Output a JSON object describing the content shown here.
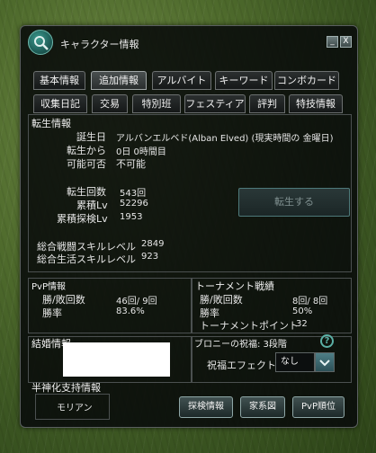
{
  "window": {
    "title": "キャラクター情報",
    "minimize_label": "_",
    "close_label": "X"
  },
  "tabs_row1": [
    {
      "label": "基本情報",
      "active": false
    },
    {
      "label": "追加情報",
      "active": true
    },
    {
      "label": "アルバイト",
      "active": false
    },
    {
      "label": "キーワード",
      "active": false
    },
    {
      "label": "コンボカード",
      "active": false
    }
  ],
  "tabs_row2": [
    {
      "label": "収集日記"
    },
    {
      "label": "交易"
    },
    {
      "label": "特別班"
    },
    {
      "label": "フェスティア"
    },
    {
      "label": "評判"
    },
    {
      "label": "特技情報"
    }
  ],
  "rebirth": {
    "section_title": "転生情報",
    "birthday_label": "誕生日",
    "birthday_value": "アルバンエルベド(Alban Elved) (現実時間の 金曜日)",
    "since_label": "転生から",
    "since_value": "0日 0時間目",
    "possible_label": "可能可否",
    "possible_value": "不可能",
    "count_label": "転生回数",
    "count_value": "543回",
    "total_level_label": "累積Lv",
    "total_level_value": "52296",
    "explore_level_label": "累積探検Lv",
    "explore_level_value": "1953",
    "button_label": "転生する"
  },
  "skills": {
    "combat_label": "総合戦闘スキルレベル",
    "combat_value": "2849",
    "life_label": "総合生活スキルレベル",
    "life_value": "923"
  },
  "pvp": {
    "title": "PvP情報",
    "wl_label": "勝/敗回数",
    "wl_value": "46回/ 9回",
    "rate_label": "勝率",
    "rate_value": "83.6%"
  },
  "tournament": {
    "title": "トーナメント戦績",
    "wl_label": "勝/敗回数",
    "wl_value": "8回/ 8回",
    "rate_label": "勝率",
    "rate_value": "50%",
    "points_label": "トーナメントポイント",
    "points_value": "32"
  },
  "marriage": {
    "title": "結婚情報"
  },
  "blessing": {
    "title": "ブロニーの祝福: 3段階",
    "help_label": "?",
    "effect_label": "祝福エフェクト",
    "effect_value": "なし"
  },
  "demigod": {
    "title": "半神化支持情報",
    "value": "モリアン"
  },
  "bottom_buttons": {
    "explore": "探検情報",
    "family": "家系図",
    "pvp_rank": "PvP順位"
  }
}
